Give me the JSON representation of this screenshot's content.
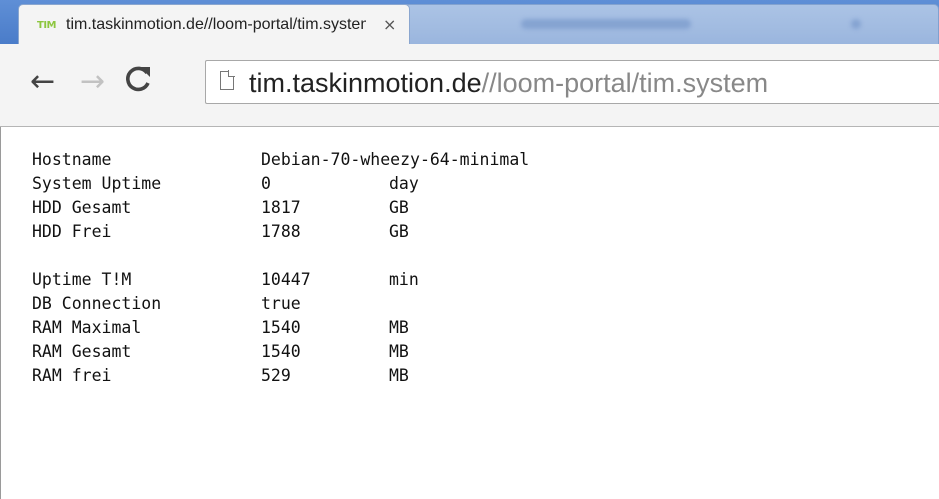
{
  "browser": {
    "active_tab": {
      "favicon_text": "TIM",
      "title": "tim.taskinmotion.de//loom-portal/tim.system",
      "close_glyph": "×"
    },
    "address_bar": {
      "host": "tim.taskinmotion.de",
      "path": "//loom-portal/tim.system"
    },
    "nav": {
      "back_glyph": "←",
      "forward_glyph": "→",
      "reload_glyph": "C"
    }
  },
  "system_info": {
    "group1": [
      {
        "label": "Hostname",
        "value": "Debian-70-wheezy-64-minimal",
        "unit": ""
      },
      {
        "label": "System Uptime",
        "value": "0",
        "unit": "day"
      },
      {
        "label": "HDD Gesamt",
        "value": "1817",
        "unit": "GB"
      },
      {
        "label": "HDD Frei",
        "value": "1788",
        "unit": "GB"
      }
    ],
    "group2": [
      {
        "label": "Uptime T!M",
        "value": "10447",
        "unit": "min"
      },
      {
        "label": "DB Connection",
        "value": "true",
        "unit": ""
      },
      {
        "label": "RAM Maximal",
        "value": "1540",
        "unit": "MB"
      },
      {
        "label": "RAM Gesamt",
        "value": "1540",
        "unit": "MB"
      },
      {
        "label": "RAM frei",
        "value": "529",
        "unit": "MB"
      }
    ]
  }
}
